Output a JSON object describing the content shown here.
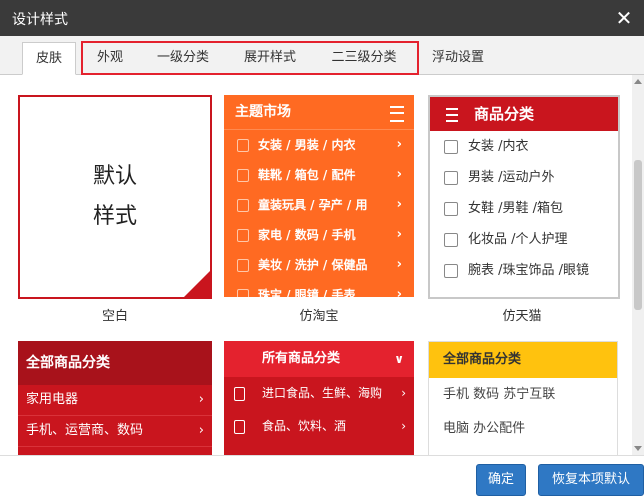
{
  "dialog": {
    "title": "设计样式"
  },
  "tabs": [
    {
      "label": "皮肤",
      "active": true
    },
    {
      "label": "外观"
    },
    {
      "label": "一级分类"
    },
    {
      "label": "展开样式"
    },
    {
      "label": "二三级分类"
    },
    {
      "label": "浮动设置"
    }
  ],
  "styles": [
    {
      "name": "空白",
      "preview": {
        "line1": "默认",
        "line2": "样式"
      }
    },
    {
      "name": "仿淘宝",
      "preview": {
        "header": "主题市场",
        "items": [
          "女装 / 男装 / 内衣",
          "鞋靴 / 箱包 / 配件",
          "童装玩具 / 孕产 / 用",
          "家电 / 数码 / 手机",
          "美妆 / 洗护 / 保健品",
          "珠宝 / 眼镜 / 手表"
        ]
      }
    },
    {
      "name": "仿天猫",
      "preview": {
        "header": "商品分类",
        "items": [
          "女装 /内衣",
          "男装 /运动户外",
          "女鞋 /男鞋 /箱包",
          "化妆品 /个人护理",
          "腕表 /珠宝饰品 /眼镜"
        ]
      }
    },
    {
      "name": "",
      "preview": {
        "header": "全部商品分类",
        "items": [
          "家用电器",
          "手机、运营商、数码"
        ]
      }
    },
    {
      "name": "",
      "preview": {
        "header": "所有商品分类",
        "items": [
          "进口食品、生鲜、海购",
          "食品、饮料、酒"
        ]
      }
    },
    {
      "name": "",
      "preview": {
        "header": "全部商品分类",
        "items": [
          "手机 数码 苏宁互联",
          "电脑 办公配件"
        ]
      }
    }
  ],
  "footer": {
    "confirm_label": "确定",
    "restore_label": "恢复本项默认"
  },
  "icons": {
    "close": "close-icon",
    "menu": "menu-icon",
    "chevron_right": "chevron-right-icon",
    "chevron_down": "chevron-down-icon"
  },
  "colors": {
    "accent_red": "#c9151e",
    "taobao_orange": "#ff6a22",
    "suning_yellow": "#ffc20e",
    "button_blue": "#2f78c4",
    "titlebar": "#3a3a3a"
  }
}
